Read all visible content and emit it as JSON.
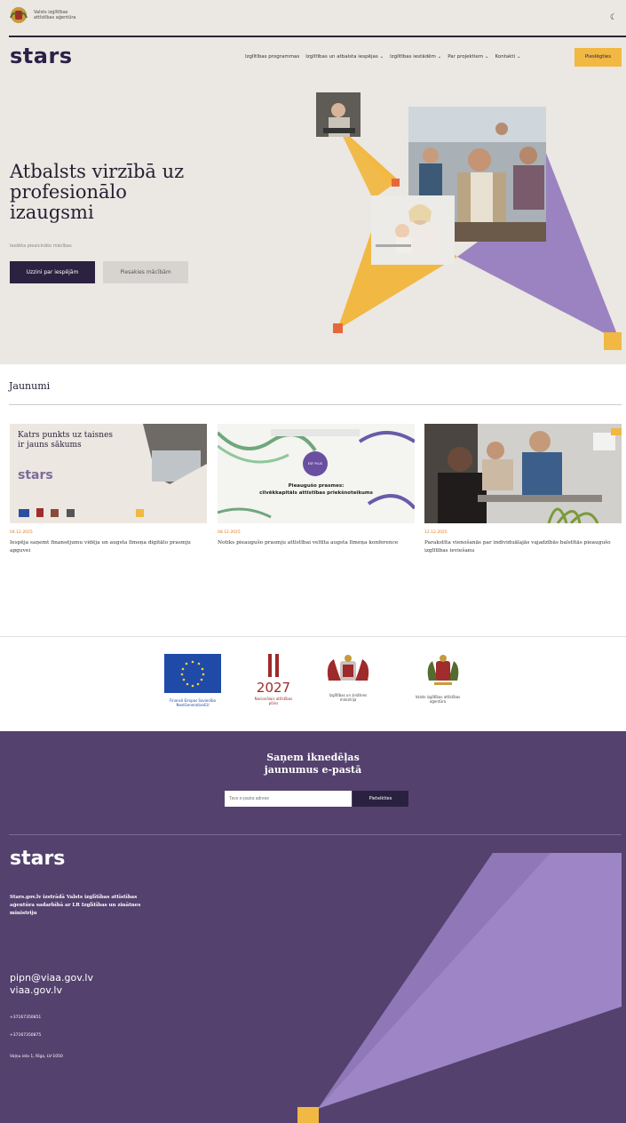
{
  "topbar": {
    "agency_name_line1": "Valsts izglītības",
    "agency_name_line2": "attīstības aģentūra",
    "theme_icon": "moon-icon"
  },
  "header": {
    "logo": "stars",
    "nav": [
      "Izglītības programmas",
      "Izglītības un atbalsta iespējas ⌄",
      "Izglītības iestādēm ⌄",
      "Par projektiem ⌄",
      "Kontakti ⌄"
    ],
    "cta_label": "Pieslēgties"
  },
  "hero": {
    "title": "Atbalsts virzībā uz profesionālo izaugsmi",
    "subtitle": "Iesākta pieaicināto mācības",
    "primary_button": "Uzzini par iespējām",
    "secondary_button": "Piesakies mācībām"
  },
  "news": {
    "section_title": "Jaunumi",
    "cards": [
      {
        "date": "04.12.2025",
        "title": "Iespēja saņemt finansējumu vidēja un augsta līmeņa digitālo prasmju apguvei",
        "image_text_1": "Katrs punkts uz taisnes",
        "image_text_2": "ir jauns sākums",
        "image_logo": "stars"
      },
      {
        "date": "08.12.2025",
        "title": "Notiks pieaugušo prasmju attīstībai veltīta augsta līmeņa konference",
        "image_text_1": "Pieaugušo prasmes:",
        "image_text_2": "cilvēkkapitāls attīstības priekšnoteikums",
        "image_badge": "ESF PLUS"
      },
      {
        "date": "12.12.2025",
        "title": "Parakstīta vienošanās par individuālajās vajadzībās balstītās pieaugušo izglītības ieviešanu"
      }
    ]
  },
  "partners": [
    {
      "caption": "Finansē Eiropas Savienība NextGenerationEU"
    },
    {
      "caption": "Nacionālais attīstības plāns",
      "year": "2027"
    },
    {
      "caption": "Izglītības un zinātnes ministrija"
    },
    {
      "caption": "Valsts izglītības attīstības aģentūra"
    }
  ],
  "footer": {
    "newsletter_title_line1": "Saņem iknedēļas",
    "newsletter_title_line2": "jaunumus e-pastā",
    "email_placeholder": "Tavs e-pasta adrese",
    "subscribe_label": "Pieteikties",
    "logo": "stars",
    "description": "Stars.gov.lv izstrādā Valsts izglītības attīstības aģentūra sadarbībā ar LR Izglītības un zinātnes ministriju",
    "email": "pipn@viaa.gov.lv",
    "website": "viaa.gov.lv",
    "phone1": "+37167350851",
    "phone2": "+37167350875",
    "address": "Vaļņu iela 1, Rīga, LV-1050"
  },
  "colors": {
    "accent_yellow": "#f1b843",
    "purple_dark": "#2b2140",
    "purple_light": "#9b83c1",
    "footer_bg": "#54416e",
    "orange": "#e8673a"
  }
}
